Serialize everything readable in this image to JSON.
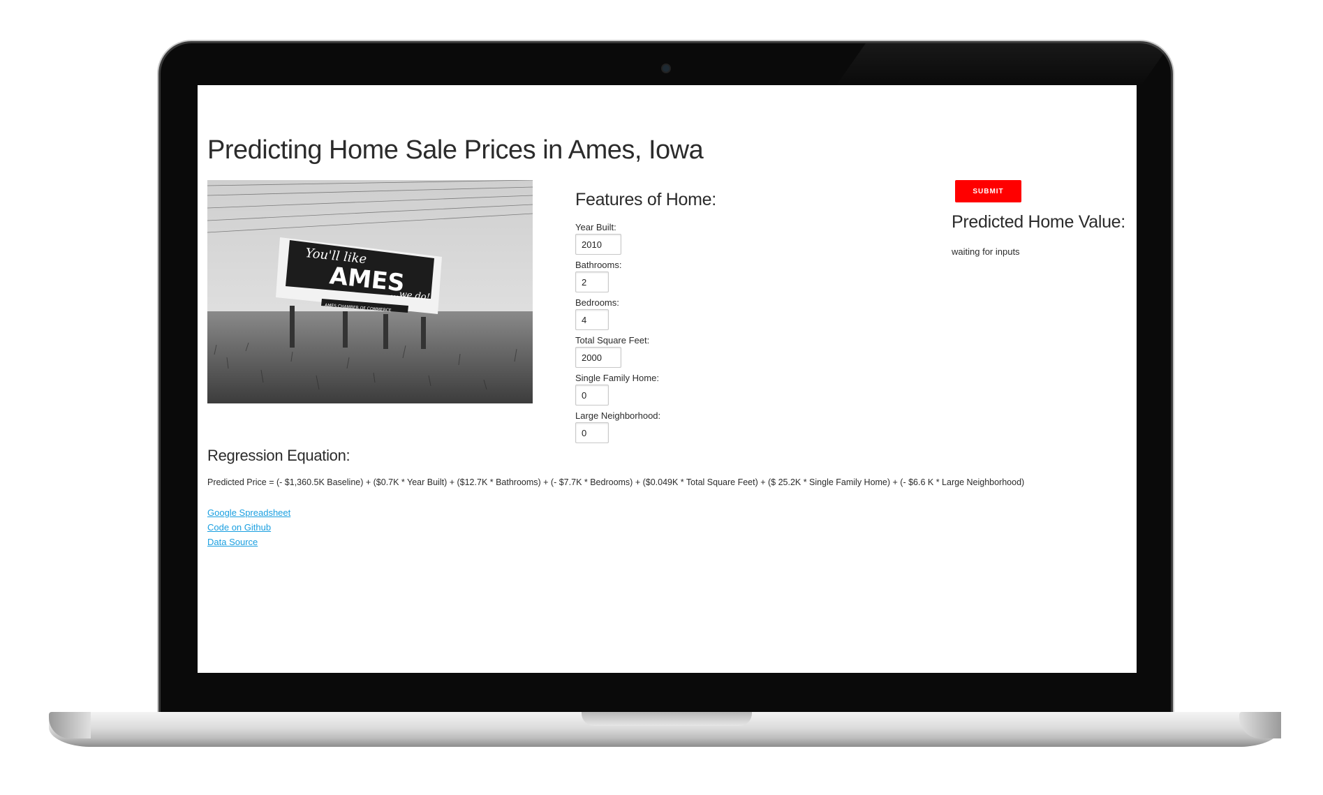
{
  "page": {
    "title": "Predicting Home Sale Prices in Ames, Iowa"
  },
  "hero_image": {
    "sign_lines": [
      "You'll like",
      "AMES",
      "...we do!"
    ],
    "sign_footer": "AMES CHAMBER OF COMMERCE"
  },
  "features": {
    "heading": "Features of Home:",
    "fields": [
      {
        "label": "Year Built:",
        "value": "2010"
      },
      {
        "label": "Bathrooms:",
        "value": "2"
      },
      {
        "label": "Bedrooms:",
        "value": "4"
      },
      {
        "label": "Total Square Feet:",
        "value": "2000"
      },
      {
        "label": "Single Family Home:",
        "value": "0"
      },
      {
        "label": "Large Neighborhood:",
        "value": "0"
      }
    ]
  },
  "results": {
    "submit_label": "SUBMIT",
    "heading": "Predicted Home Value:",
    "value_text": "waiting for inputs"
  },
  "regression": {
    "heading": "Regression Equation:",
    "equation": "Predicted Price = (- $1,360.5K Baseline) + ($0.7K * Year Built) + ($12.7K * Bathrooms) + (- $7.7K * Bedrooms) + ($0.049K * Total Square Feet) + ($ 25.2K * Single Family Home) + (- $6.6 K * Large Neighborhood)"
  },
  "links": [
    {
      "label": "Google Spreadsheet"
    },
    {
      "label": "Code on Github"
    },
    {
      "label": "Data Source"
    }
  ],
  "colors": {
    "submit_bg": "#ff0000",
    "link": "#1a9fe0",
    "text": "#2b2b2b"
  }
}
